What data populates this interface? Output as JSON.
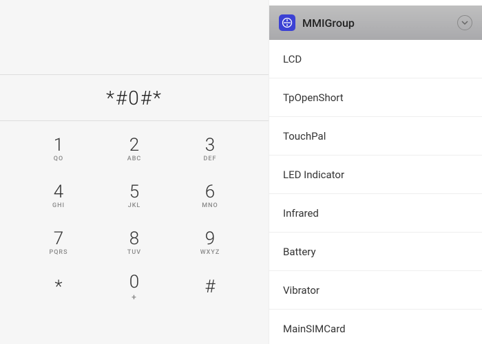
{
  "dialer": {
    "display_value": "*#0#*",
    "keys": [
      [
        {
          "digit": "1",
          "letters": "QO"
        },
        {
          "digit": "2",
          "letters": "ABC"
        },
        {
          "digit": "3",
          "letters": "DEF"
        }
      ],
      [
        {
          "digit": "4",
          "letters": "GHI"
        },
        {
          "digit": "5",
          "letters": "JKL"
        },
        {
          "digit": "6",
          "letters": "MNO"
        }
      ],
      [
        {
          "digit": "7",
          "letters": "PQRS"
        },
        {
          "digit": "8",
          "letters": "TUV"
        },
        {
          "digit": "9",
          "letters": "WXYZ"
        }
      ],
      [
        {
          "digit": "*",
          "letters": ""
        },
        {
          "digit": "0",
          "letters": "+"
        },
        {
          "digit": "#",
          "letters": ""
        }
      ]
    ]
  },
  "mmi": {
    "title": "MMIGroup",
    "items": [
      {
        "label": "LCD"
      },
      {
        "label": "TpOpenShort"
      },
      {
        "label": "TouchPal"
      },
      {
        "label": "LED Indicator"
      },
      {
        "label": "Infrared"
      },
      {
        "label": "Battery"
      },
      {
        "label": "Vibrator"
      },
      {
        "label": "MainSIMCard"
      }
    ]
  }
}
